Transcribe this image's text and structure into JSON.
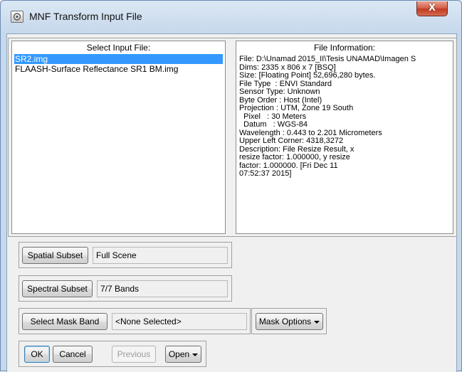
{
  "window": {
    "title": "MNF Transform Input File",
    "close_glyph": "X"
  },
  "input_panel": {
    "header": "Select Input File:",
    "files": [
      {
        "name": "SR2.img",
        "selected": true
      },
      {
        "name": "FLAASH-Surface Reflectance SR1 BM.img",
        "selected": false
      }
    ]
  },
  "info_panel": {
    "header": "File Information:",
    "lines": [
      "File: D:\\Unamad 2015_II\\Tesis UNAMAD\\Imagen S",
      "Dims: 2335 x 806 x 7 [BSQ]",
      "Size: [Floating Point] 52,696,280 bytes.",
      "File Type  : ENVI Standard",
      "Sensor Type: Unknown",
      "Byte Order : Host (Intel)",
      "Projection : UTM, Zone 19 South",
      "  Pixel   : 30 Meters",
      "  Datum   : WGS-84",
      "Wavelength : 0.443 to 2.201 Micrometers",
      "Upper Left Corner: 4318,3272",
      "Description: File Resize Result, x",
      "resize factor: 1.000000, y resize",
      "factor: 1.000000. [Fri Dec 11",
      "07:52:37 2015]"
    ]
  },
  "spatial": {
    "button": "Spatial Subset",
    "value": "Full Scene"
  },
  "spectral": {
    "button": "Spectral Subset",
    "value": "7/7 Bands"
  },
  "mask": {
    "button": "Select Mask Band",
    "value": "<None Selected>",
    "options_button": "Mask Options"
  },
  "actions": {
    "ok": "OK",
    "cancel": "Cancel",
    "previous": "Previous",
    "open": "Open"
  },
  "icons": {
    "app": "window-app-icon",
    "close": "close-icon",
    "dropdown": "chevron-down-icon"
  }
}
